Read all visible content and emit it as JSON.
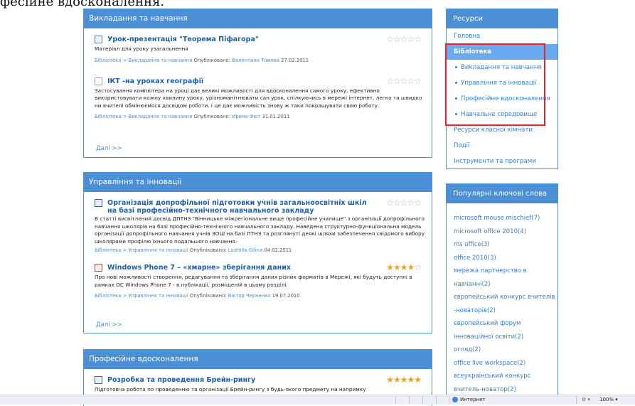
{
  "top_text": "фесійне вдосконалення.",
  "sections": [
    {
      "title": "Викладання та навчання",
      "items": [
        {
          "title": "Урок-презентація \"Теорема Піфагора\"",
          "icon": "document-icon",
          "rating": 0,
          "desc": "Матеріал для уроку узагальнення",
          "path": "Бібліотека > Викладання та навчання",
          "published_label": "Опубліковано:",
          "author": "Валентина Томева",
          "date": "27.02.2011"
        },
        {
          "title": "ІКТ -на уроках географії",
          "icon": "powerpoint-icon",
          "rating": 0,
          "desc": "Застосування компютера на уроці дає великі можливості для вдосконалення самого уроку, ефективно використовувати кожну хвилину уроку, урізноманітнювати сан урок, спілкуючись в мережі інтернет, легко та швидко ни вчителі обмінюємося досвідом роботи. і це дає можливість знову ж таки покращувати свою роботу.",
          "path": "Бібліотека > Викладання та навчання",
          "published_label": "Опубліковано:",
          "author": "Ирина Фют",
          "date": "31.01.2011"
        }
      ],
      "more": "Далі >>"
    },
    {
      "title": "Управління та інновації",
      "items": [
        {
          "title": "Організація допрофільної підготовки учнів загальноосвітніх шкіл на базі професійно-технічного навчального закладу",
          "icon": "word-icon",
          "rating": 0,
          "desc": "В статті висвітлений досвід ДПТНЗ \"Вінницьке міжрегіональне вище професійне училище\" з організації допрофільного навчання школярів на базі професійно-технічного навчального закладу. Наведена структурно-функціональна модель організації допрофільного навчання учнів ЗОШ на базі ПТНЗ та розглянуті деякі шляхи забезпечення свідомого вибору школярами профілю їхнього подальшого навчання.",
          "path": "Бібліотека > Управління та інновації",
          "published_label": "Опубліковано:",
          "author": "Ludmila Gilina",
          "date": "04.02.2011"
        },
        {
          "title": "Windows Phone 7 – «хмарне» зберігання даних",
          "icon": "pdf-icon",
          "rating": 4,
          "desc": "Про нові можливості створення, редагування та зберігання даних різних форматів в Мережі, які будуть доступні в рамках ОС Windows Phone 7 - в публікації, розміщеній в цьому розділі.",
          "path": "Бібліотека > Управління та інновації",
          "published_label": "Опубліковано:",
          "author": "Віктор Черненко",
          "date": "19.07.2010"
        }
      ],
      "more": "Далі >>"
    },
    {
      "title": "Професійне вдосконалення",
      "items": [
        {
          "title": "Розробка та проведення Брейн-рингу",
          "icon": "word-icon",
          "rating": 5,
          "desc": "Підготовча робота по проведенню та організації Брейн-рингу з будь-якого предмету на напримку"
        }
      ]
    }
  ],
  "sidebar": {
    "resources_title": "Ресурси",
    "nav": [
      {
        "label": "Головна",
        "type": "link"
      },
      {
        "label": "Бібліотека",
        "type": "active"
      },
      {
        "label": "Викладання та навчання",
        "type": "sub"
      },
      {
        "label": "Управління та інновації",
        "type": "sub"
      },
      {
        "label": "Професійне вдосконалення",
        "type": "sub"
      },
      {
        "label": "Навчальне середовище",
        "type": "sub"
      },
      {
        "label": "Ресурси класної кімнати",
        "type": "link"
      },
      {
        "label": "Події",
        "type": "link"
      },
      {
        "label": "Інструменти та програми",
        "type": "link"
      }
    ],
    "keywords_title": "Популярні ключові слова",
    "keywords": [
      "microsoft mouse mischief(7)",
      "microsoft office 2010(4)",
      "ms office(3)",
      "office 2010(3)",
      "мережа партнерство в",
      "навчанні(2)",
      "європейський конкурс вчителів",
      "-новаторів(2)",
      "європейський форум",
      "інноваційної освіти(2)",
      "огляд(2)",
      "office live workspace(2)",
      "всеукраїнський конкурс",
      "вчитель-новатор(2)"
    ]
  },
  "statusbar": {
    "zone": "Интернет",
    "zoom": "100%",
    "zoom_arrow": "▾",
    "protect": "⚙ ▾"
  },
  "colors": {
    "header_blue": "#4b8fd6",
    "active_blue": "#6aaaf0",
    "highlight_red": "#e8242a",
    "star_gold": "#f0a21a"
  }
}
